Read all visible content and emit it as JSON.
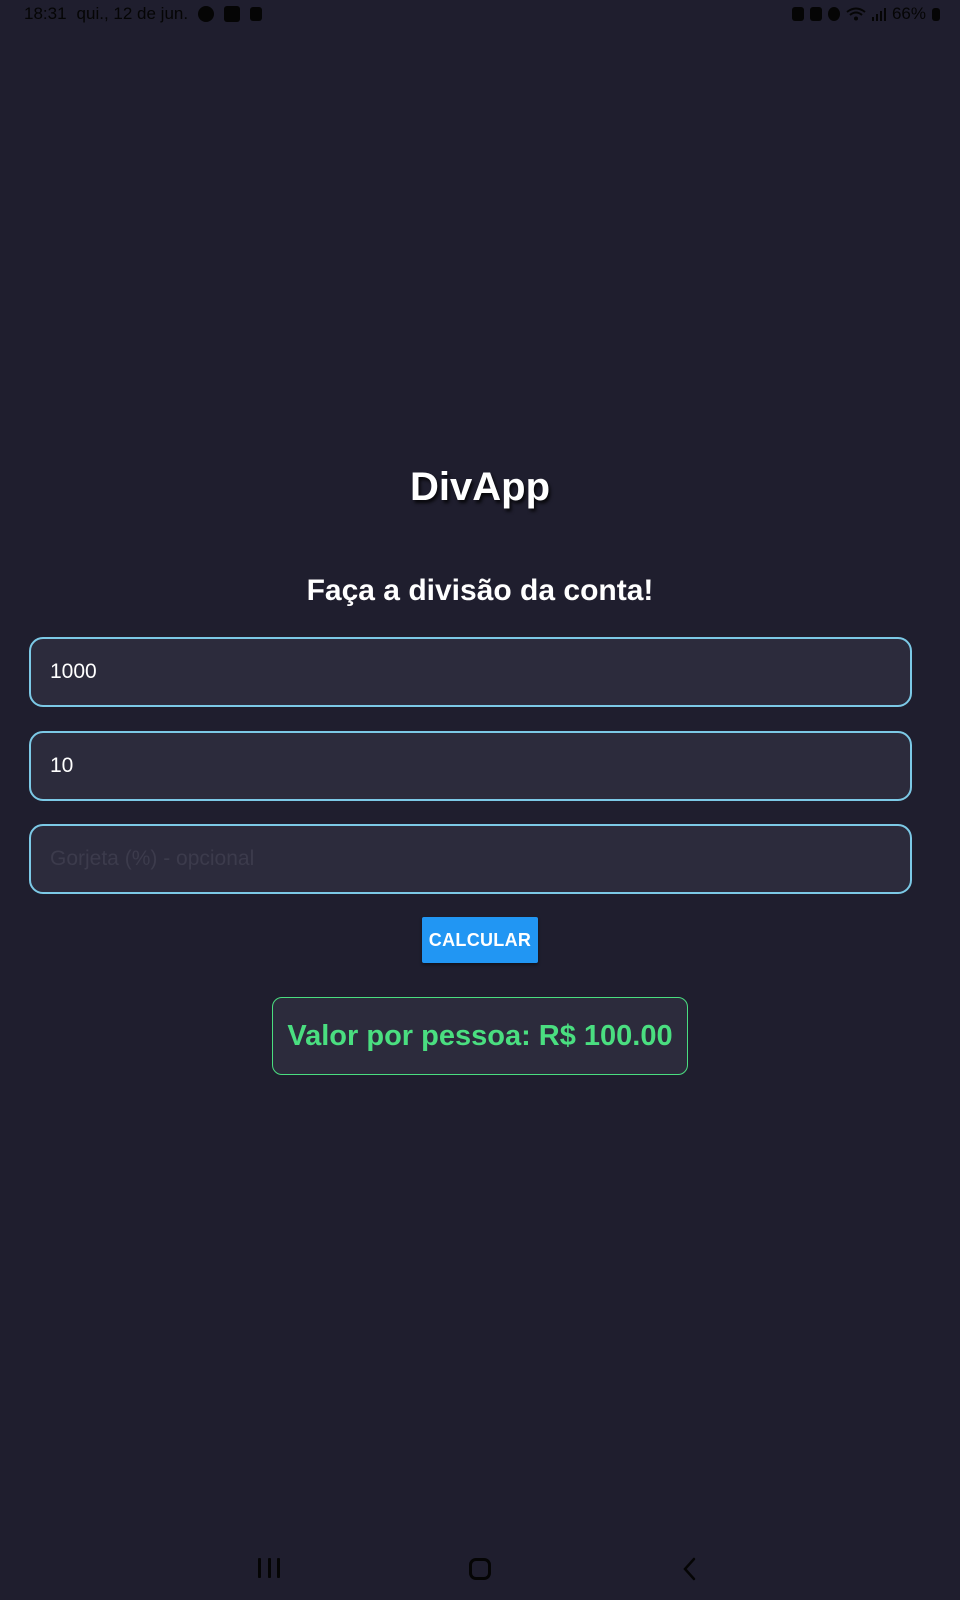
{
  "status_bar": {
    "time": "18:31",
    "date": "qui., 12 de jun.",
    "battery": "66%"
  },
  "app": {
    "title": "DivApp",
    "subtitle": "Faça a divisão da conta!"
  },
  "form": {
    "total_value": "1000",
    "people_value": "10",
    "tip_value": "",
    "tip_placeholder": "Gorjeta (%) - opcional",
    "calculate_label": "CALCULAR"
  },
  "result": {
    "text": "Valor por pessoa: R$ 100.00"
  },
  "colors": {
    "background": "#1f1e2e",
    "input_border": "#7cc9e6",
    "button": "#2196f3",
    "result_accent": "#4ade80"
  },
  "icons": {
    "status_left": [
      "a-circle-icon",
      "image-icon",
      "calendar-icon"
    ],
    "status_right": [
      "alarm-icon",
      "mute-icon",
      "wifi-icon",
      "signal-icon",
      "battery-icon"
    ],
    "nav": [
      "recents-icon",
      "home-icon",
      "back-icon"
    ]
  }
}
